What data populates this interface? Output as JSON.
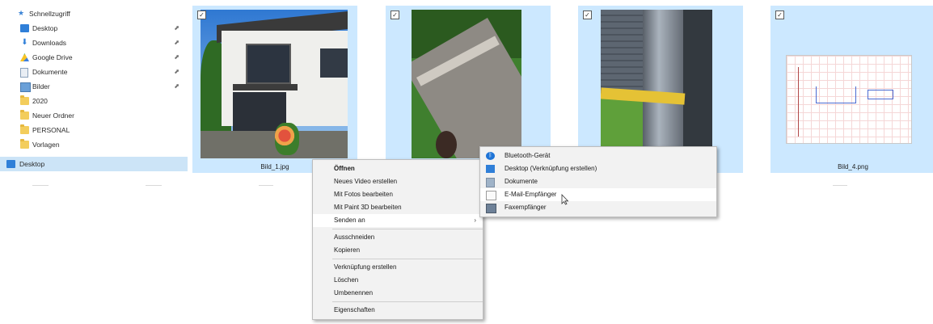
{
  "nav": {
    "items": [
      {
        "label": "Schnellzugriff",
        "icon": "star-icon",
        "pinned": false
      },
      {
        "label": "Desktop",
        "icon": "desktop-icon",
        "pinned": true
      },
      {
        "label": "Downloads",
        "icon": "download-icon",
        "pinned": true
      },
      {
        "label": "Google Drive",
        "icon": "google-drive-icon",
        "pinned": true
      },
      {
        "label": "Dokumente",
        "icon": "documents-icon",
        "pinned": true
      },
      {
        "label": "Bilder",
        "icon": "pictures-icon",
        "pinned": true
      },
      {
        "label": "2020",
        "icon": "folder-icon",
        "pinned": false
      },
      {
        "label": "Neuer Ordner",
        "icon": "folder-icon",
        "pinned": false
      },
      {
        "label": "PERSONAL",
        "icon": "folder-icon",
        "pinned": false
      },
      {
        "label": "Vorlagen",
        "icon": "folder-icon",
        "pinned": false
      }
    ],
    "selected_label": "Desktop",
    "pin_glyph": "⬈"
  },
  "files": [
    {
      "name": "Bild_1.jpg",
      "checked": true
    },
    {
      "name": "",
      "checked": true
    },
    {
      "name": "",
      "checked": true
    },
    {
      "name": "Bild_4.png",
      "checked": true
    }
  ],
  "context_menu": {
    "items": [
      {
        "label": "Öffnen",
        "bold": true
      },
      {
        "label": "Neues Video erstellen"
      },
      {
        "label": "Mit Fotos bearbeiten"
      },
      {
        "label": "Mit Paint 3D bearbeiten"
      },
      {
        "label": "Senden an",
        "submenu": true
      },
      {
        "label": "Ausschneiden"
      },
      {
        "label": "Kopieren"
      },
      {
        "label": "Verknüpfung erstellen"
      },
      {
        "label": "Löschen"
      },
      {
        "label": "Umbenennen"
      },
      {
        "label": "Eigenschaften"
      }
    ],
    "submenu_arrow": "›"
  },
  "send_to_menu": {
    "items": [
      {
        "label": "Bluetooth-Gerät",
        "icon": "bluetooth-icon"
      },
      {
        "label": "Desktop (Verknüpfung erstellen)",
        "icon": "desktop-icon"
      },
      {
        "label": "Dokumente",
        "icon": "documents-icon"
      },
      {
        "label": "E-Mail-Empfänger",
        "icon": "mail-icon"
      },
      {
        "label": "Faxempfänger",
        "icon": "fax-icon"
      }
    ]
  },
  "colors": {
    "selection": "#cce8ff",
    "nav_selection": "#cce4f7",
    "menu_bg": "#f2f2f2"
  }
}
